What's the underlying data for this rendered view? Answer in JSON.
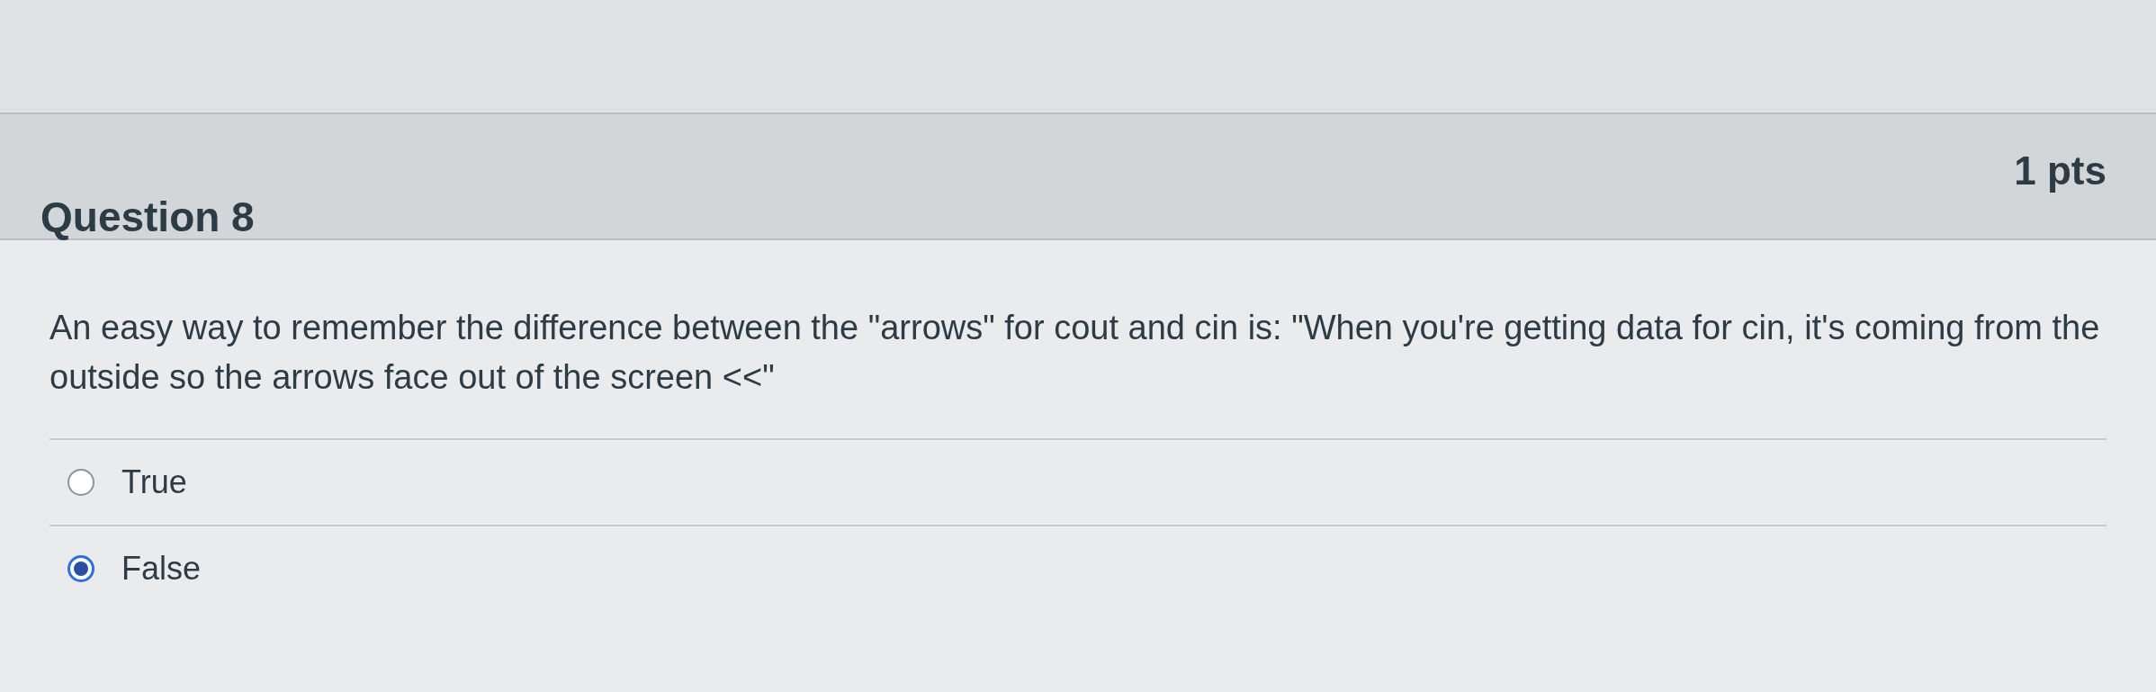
{
  "question": {
    "title": "Question 8",
    "points": "1 pts",
    "text": "An easy way to remember the difference between the \"arrows\" for cout and cin is: \"When you're getting data for cin, it's coming from the outside so the arrows face out of the screen <<\"",
    "answers": [
      {
        "label": "True",
        "selected": false
      },
      {
        "label": "False",
        "selected": true
      }
    ]
  }
}
